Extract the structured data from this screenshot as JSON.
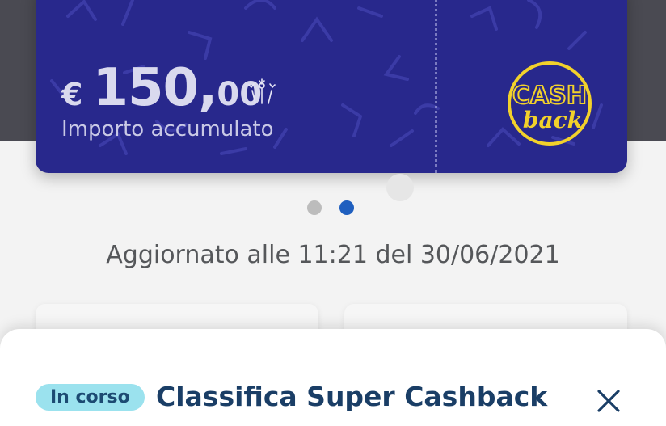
{
  "card": {
    "currency": "€",
    "amount_integer": "150,",
    "amount_decimals": "00",
    "label": "Importo accumulato",
    "logo_text_top": "CASH",
    "logo_text_bottom": "back",
    "colors": {
      "card_bg": "#28288c",
      "logo_yellow": "#f2d12b"
    }
  },
  "carousel": {
    "page_count": 2,
    "active_index": 1
  },
  "updated_text": "Aggiornato alle 11:21 del 30/06/2021",
  "sheet": {
    "badge": "In corso",
    "title": "Classifica Super Cashback",
    "close_icon": "close-icon"
  }
}
